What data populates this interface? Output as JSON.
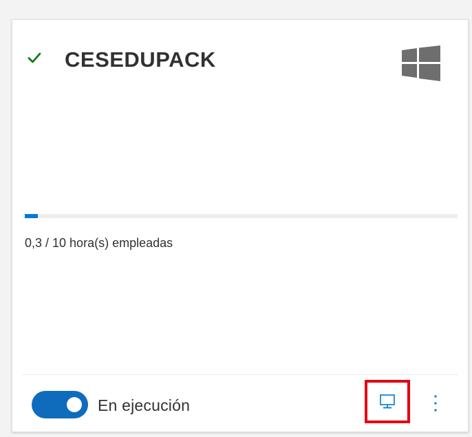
{
  "card": {
    "title": "CESEDUPACK",
    "status_icon": "checkmark-icon",
    "os_icon": "windows-logo-icon",
    "usage": {
      "text": "0,3 / 10 hora(s) empleadas",
      "used_fraction": 0.03
    },
    "footer": {
      "toggle_state": "on",
      "toggle_label": "En ejecución",
      "connect_icon": "monitor-icon",
      "more_icon": "more-vertical-icon"
    }
  },
  "colors": {
    "accent": "#0078d4",
    "toggle_on": "#0f6cbd",
    "success": "#107c10",
    "highlight_border": "#e60012",
    "os_icon": "#6e6e6e"
  }
}
